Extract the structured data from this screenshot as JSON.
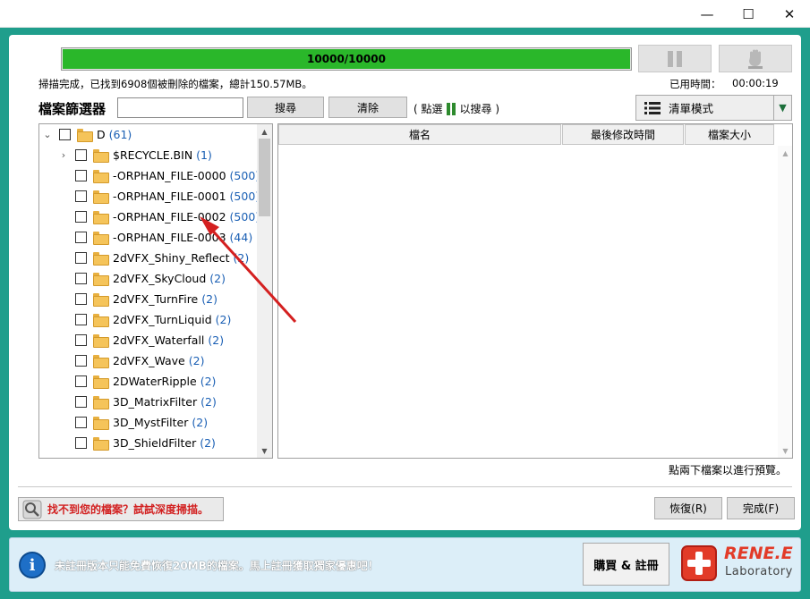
{
  "window": {
    "minimize": "—",
    "maximize": "☐",
    "close": "✕"
  },
  "progress": {
    "text": "10000/10000",
    "value": 1.0
  },
  "status": {
    "scan_result": "掃描完成，已找到6908個被刪除的檔案，總計150.57MB。",
    "time_label": "已用時間：",
    "time_value": "00:00:19"
  },
  "filter": {
    "label": "檔案篩選器",
    "input_value": "",
    "search_button": "搜尋",
    "clear_button": "清除",
    "hint_prefix": "( 點選",
    "hint_suffix": "以搜尋 )"
  },
  "view_mode": {
    "selected": "清單模式"
  },
  "tree": {
    "root": {
      "name": "D",
      "count": "(61)"
    },
    "items": [
      {
        "name": "$RECYCLE.BIN",
        "count": "(1)"
      },
      {
        "name": "-ORPHAN_FILE-0000",
        "count": "(500)"
      },
      {
        "name": "-ORPHAN_FILE-0001",
        "count": "(500)"
      },
      {
        "name": "-ORPHAN_FILE-0002",
        "count": "(500)"
      },
      {
        "name": "-ORPHAN_FILE-0003",
        "count": "(44)"
      },
      {
        "name": "2dVFX_Shiny_Reflect",
        "count": "(2)"
      },
      {
        "name": "2dVFX_SkyCloud",
        "count": "(2)"
      },
      {
        "name": "2dVFX_TurnFire",
        "count": "(2)"
      },
      {
        "name": "2dVFX_TurnLiquid",
        "count": "(2)"
      },
      {
        "name": "2dVFX_Waterfall",
        "count": "(2)"
      },
      {
        "name": "2dVFX_Wave",
        "count": "(2)"
      },
      {
        "name": "2DWaterRipple",
        "count": "(2)"
      },
      {
        "name": "3D_MatrixFilter",
        "count": "(2)"
      },
      {
        "name": "3D_MystFilter",
        "count": "(2)"
      },
      {
        "name": "3D_ShieldFilter",
        "count": "(2)"
      }
    ]
  },
  "list": {
    "columns": [
      "檔名",
      "最後修改時間",
      "檔案大小"
    ]
  },
  "preview_hint": "點兩下檔案以進行預覽。",
  "deep_scan": "找不到您的檔案？試試深度掃描。",
  "buttons": {
    "recover": "恢復(R)",
    "finish": "完成(F)"
  },
  "footer": {
    "info_glyph": "i",
    "message": "未註冊版本只能免費恢復20MB的檔案。馬上註冊獲取獨家優惠吧！",
    "buy_button": "購買 & 註冊",
    "logo_name": "RENE.E",
    "logo_sub": "Laboratory"
  },
  "colors": {
    "progress_fill": "#2ab72a",
    "accent_teal": "#1f9e8c",
    "deep_scan_text": "#d21f1f",
    "annotation_arrow": "#d42020"
  }
}
